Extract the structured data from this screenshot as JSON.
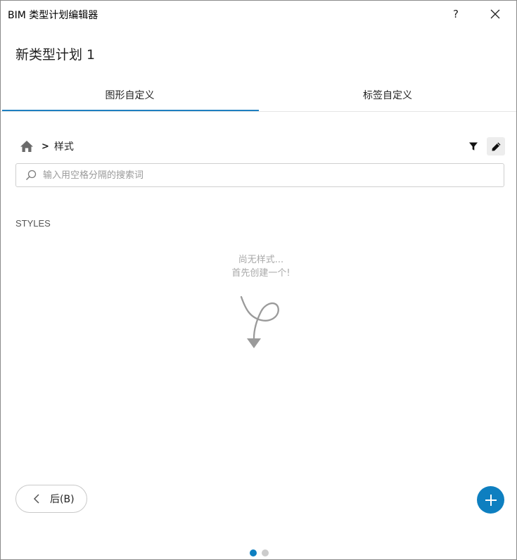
{
  "window": {
    "title": "BIM 类型计划编辑器",
    "help_label": "?",
    "close_label": "close"
  },
  "plan_name": "新类型计划 1",
  "tabs": [
    {
      "label": "图形自定义",
      "active": true
    },
    {
      "label": "标签自定义",
      "active": false
    }
  ],
  "breadcrumb": {
    "separator": ">",
    "current": "样式"
  },
  "search": {
    "placeholder": "输入用空格分隔的搜索词",
    "value": ""
  },
  "styles_section": {
    "label": "STYLES"
  },
  "empty_state": {
    "line1": "尚无样式...",
    "line2": "首先创建一个!"
  },
  "footer": {
    "back_label": "后(B)",
    "pager": {
      "current": 1,
      "total": 2
    }
  },
  "colors": {
    "accent": "#1e7fc0",
    "fab": "#0e7fc0",
    "dot_active": "#0e7fc0",
    "dot_inactive": "#cccccc",
    "arrow": "#9a9a9a"
  },
  "icons": [
    "help-icon",
    "close-icon",
    "home-icon",
    "filter-icon",
    "pencil-icon",
    "search-icon",
    "chevron-left-icon",
    "plus-icon",
    "curly-arrow-icon"
  ]
}
